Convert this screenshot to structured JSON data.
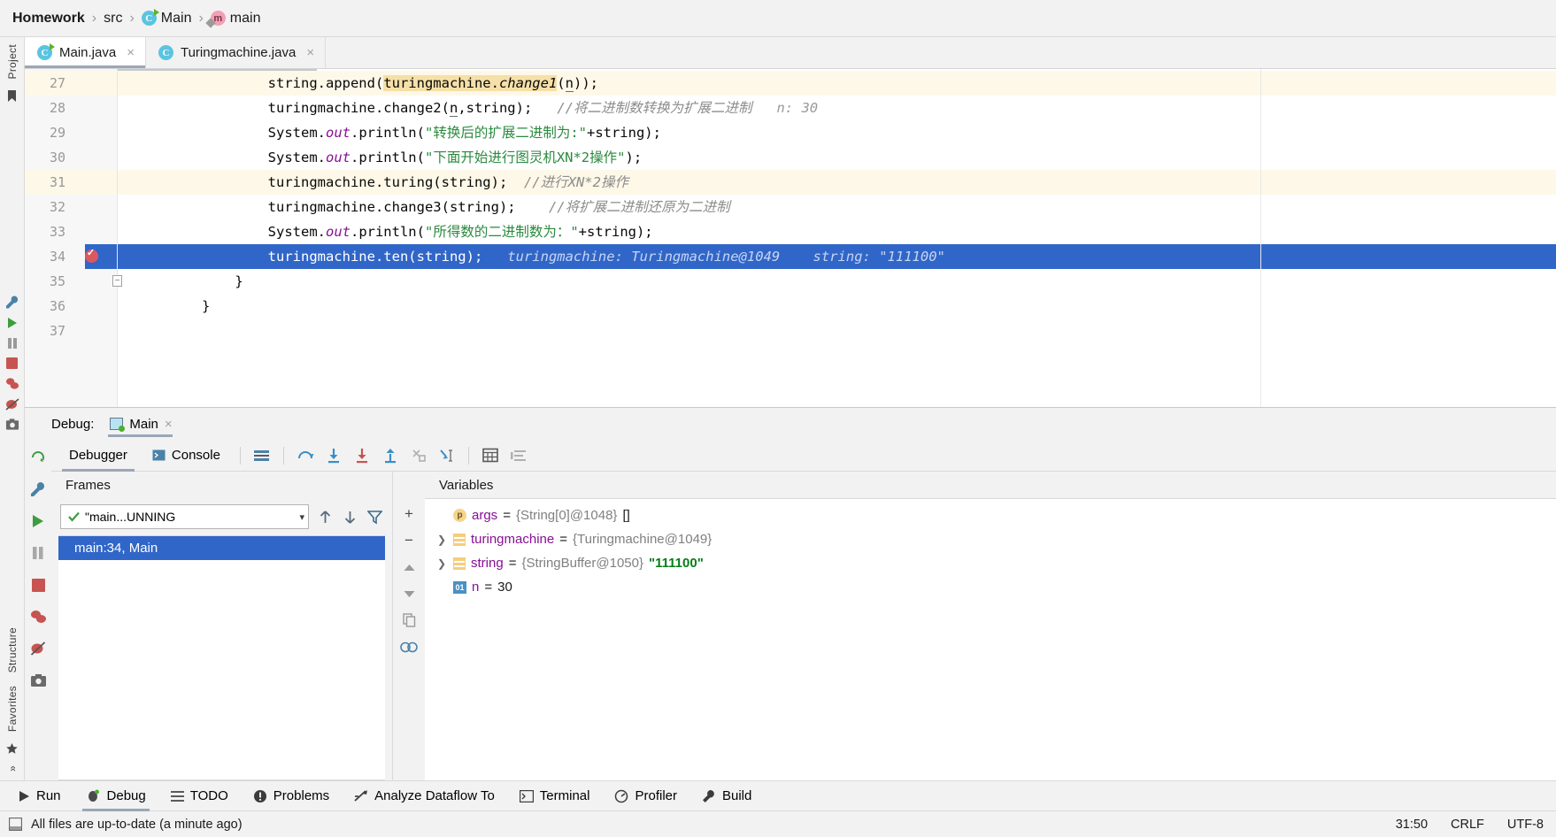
{
  "breadcrumb": {
    "items": [
      {
        "label": "Homework",
        "icon": "",
        "bold": true
      },
      {
        "label": "src",
        "icon": "",
        "bold": false
      },
      {
        "label": "Main",
        "icon": "class-icon",
        "bold": false
      },
      {
        "label": "main",
        "icon": "method-icon",
        "bold": false
      }
    ],
    "separator": "›"
  },
  "left_strip": {
    "project_label": "Project",
    "structure_label": "Structure",
    "favorites_label": "Favorites",
    "more_label": "»",
    "icons": [
      "bookmark-icon",
      "wrench-icon",
      "run-icon",
      "pause-icon",
      "stop-icon",
      "coverage-icon",
      "nostep-icon",
      "camera-icon",
      "star-icon"
    ]
  },
  "tabs": [
    {
      "label": "Main.java",
      "icon": "java-class-runnable-icon",
      "active": true,
      "close": "×"
    },
    {
      "label": "Turingmachine.java",
      "icon": "java-class-icon",
      "active": false,
      "close": "×"
    }
  ],
  "editor": {
    "first_line": 27,
    "lines": [
      {
        "num": 27,
        "highlight": "soft",
        "segments": [
          {
            "t": "        string.append(",
            "c": "plain"
          },
          {
            "t": "turingmachine.",
            "c": "search"
          },
          {
            "t": "change1",
            "c": "search-italic"
          },
          {
            "t": "(",
            "c": "plain"
          },
          {
            "t": "n",
            "c": "plain-underline"
          },
          {
            "t": "));",
            "c": "plain"
          }
        ]
      },
      {
        "num": 28,
        "highlight": "none",
        "segments": [
          {
            "t": "        turingmachine.change2(",
            "c": "plain"
          },
          {
            "t": "n",
            "c": "plain-underline"
          },
          {
            "t": ",string);",
            "c": "plain"
          },
          {
            "t": "   ",
            "c": "plain"
          },
          {
            "t": "//将二进制数转换为扩展二进制",
            "c": "comment"
          },
          {
            "t": "   n: 30",
            "c": "inline-dbg"
          }
        ]
      },
      {
        "num": 29,
        "highlight": "none",
        "segments": [
          {
            "t": "        System.",
            "c": "plain"
          },
          {
            "t": "out",
            "c": "field"
          },
          {
            "t": ".println(",
            "c": "plain"
          },
          {
            "t": "\"转换后的扩展二进制为:\"",
            "c": "str"
          },
          {
            "t": "+string);",
            "c": "plain"
          }
        ]
      },
      {
        "num": 30,
        "highlight": "none",
        "segments": [
          {
            "t": "        System.",
            "c": "plain"
          },
          {
            "t": "out",
            "c": "field"
          },
          {
            "t": ".println(",
            "c": "plain"
          },
          {
            "t": "\"下面开始进行图灵机XN*2操作\"",
            "c": "str"
          },
          {
            "t": ");",
            "c": "plain"
          }
        ]
      },
      {
        "num": 31,
        "highlight": "soft",
        "segments": [
          {
            "t": "        turingmachine.turing(string);",
            "c": "plain"
          },
          {
            "t": "  ",
            "c": "plain"
          },
          {
            "t": "//进行XN*2操作",
            "c": "comment"
          }
        ]
      },
      {
        "num": 32,
        "highlight": "none",
        "segments": [
          {
            "t": "        turingmachine.change3(string);",
            "c": "plain"
          },
          {
            "t": "    ",
            "c": "plain"
          },
          {
            "t": "//将扩展二进制还原为二进制",
            "c": "comment"
          }
        ]
      },
      {
        "num": 33,
        "highlight": "none",
        "segments": [
          {
            "t": "        System.",
            "c": "plain"
          },
          {
            "t": "out",
            "c": "field"
          },
          {
            "t": ".println(",
            "c": "plain"
          },
          {
            "t": "\"所得数的二进制数为：\"",
            "c": "str"
          },
          {
            "t": "+string);",
            "c": "plain"
          }
        ]
      },
      {
        "num": 34,
        "highlight": "current",
        "breakpoint": true,
        "segments": [
          {
            "t": "        turingmachine.ten(string);",
            "c": "plain"
          },
          {
            "t": "   ",
            "c": "plain"
          },
          {
            "t": "turingmachine: Turingmachine@1049    string: \"111100\"",
            "c": "inline-dbg"
          }
        ]
      },
      {
        "num": 35,
        "highlight": "none",
        "fold": true,
        "segments": [
          {
            "t": "    }",
            "c": "plain"
          }
        ]
      },
      {
        "num": 36,
        "highlight": "none",
        "segments": [
          {
            "t": "}",
            "c": "plain"
          }
        ]
      },
      {
        "num": 37,
        "highlight": "none",
        "segments": [
          {
            "t": "",
            "c": "plain"
          }
        ]
      }
    ]
  },
  "debug": {
    "header_label": "Debug:",
    "session_name": "Main",
    "session_close": "×",
    "tabs": [
      {
        "label": "Debugger",
        "icon": "debugger-icon",
        "active": true
      },
      {
        "label": "Console",
        "icon": "console-icon",
        "active": false
      }
    ],
    "toolbar_icons": [
      "layout-settings-icon",
      "step-over-icon",
      "step-into-icon",
      "force-step-into-icon",
      "step-out-icon",
      "drop-frame-icon",
      "run-to-cursor-icon",
      "evaluate-expression-icon",
      "mute-breakpoints-icon"
    ],
    "left_strip_icons": [
      "rerun-icon",
      "settings-wrench-icon",
      "resume-icon",
      "pause-icon",
      "stop-icon",
      "coverage-icon",
      "mute-icon",
      "camera-icon"
    ],
    "frames": {
      "title": "Frames",
      "thread_value": "\"main...UNNING",
      "thread_status_icon": "check-icon",
      "dropdown_arrow": "▾",
      "up_icon": "arrow-up-icon",
      "down_icon": "arrow-down-icon",
      "filter_icon": "filter-icon",
      "items": [
        {
          "label": "main:34, Main",
          "selected": true
        }
      ]
    },
    "variables": {
      "title": "Variables",
      "side_buttons": [
        "add-watch-icon",
        "remove-watch-icon",
        "move-up-icon",
        "move-down-icon",
        "copy-icon",
        "inspect-icon"
      ],
      "rows": [
        {
          "expandable": false,
          "icon": "parameter-icon",
          "icon_text": "p",
          "name": "args",
          "eq": " = ",
          "type": "{String[0]@1048} ",
          "value": "[]",
          "value_kind": "plain"
        },
        {
          "expandable": true,
          "icon": "object-icon",
          "icon_text": "",
          "name": "turingmachine",
          "eq": " = ",
          "type": "{Turingmachine@1049}",
          "value": "",
          "value_kind": "plain"
        },
        {
          "expandable": true,
          "icon": "object-icon",
          "icon_text": "",
          "name": "string",
          "eq": " = ",
          "type": "{StringBuffer@1050} ",
          "value": "\"111100\"",
          "value_kind": "string"
        },
        {
          "expandable": false,
          "icon": "number-icon",
          "icon_text": "01",
          "name": "n",
          "eq": " = ",
          "type": "",
          "value": "30",
          "value_kind": "number"
        }
      ]
    }
  },
  "bottom_bar": {
    "items": [
      {
        "label": "Run",
        "icon": "run-icon",
        "active": false
      },
      {
        "label": "Debug",
        "icon": "debug-icon",
        "active": true
      },
      {
        "label": "TODO",
        "icon": "todo-icon",
        "active": false
      },
      {
        "label": "Problems",
        "icon": "problems-icon",
        "active": false
      },
      {
        "label": "Analyze Dataflow To",
        "icon": "dataflow-icon",
        "active": false
      },
      {
        "label": "Terminal",
        "icon": "terminal-icon",
        "active": false
      },
      {
        "label": "Profiler",
        "icon": "profiler-icon",
        "active": false
      },
      {
        "label": "Build",
        "icon": "build-icon",
        "active": false
      }
    ]
  },
  "status_bar": {
    "icon": "event-log-icon",
    "message": "All files are up-to-date (a minute ago)",
    "caret_position": "31:50",
    "line_separator": "CRLF",
    "encoding": "UTF-8"
  }
}
